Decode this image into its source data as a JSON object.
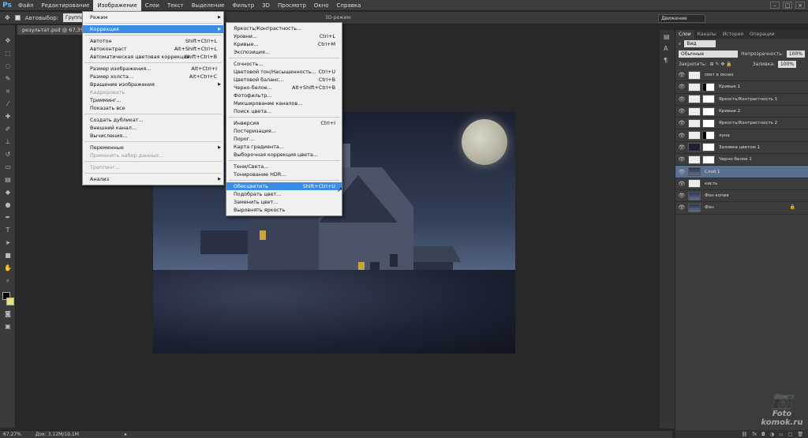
{
  "app": {
    "logo": "Ps"
  },
  "menubar": [
    "Файл",
    "Редактирование",
    "Изображение",
    "Слои",
    "Текст",
    "Выделение",
    "Фильтр",
    "3D",
    "Просмотр",
    "Окно",
    "Справка"
  ],
  "optbar": {
    "autoselect": "Автовыбор:",
    "group": "Группа",
    "mode3d": "3D-режим:",
    "workspace": "Движение"
  },
  "document": {
    "tab": "результат.psd @ 67,3% (С..."
  },
  "image_menu": [
    {
      "label": "Режим",
      "arrow": true
    },
    {
      "sep": true
    },
    {
      "label": "Коррекция",
      "arrow": true,
      "hl": true
    },
    {
      "sep": true
    },
    {
      "label": "Автотон",
      "sc": "Shift+Ctrl+L"
    },
    {
      "label": "Автоконтраст",
      "sc": "Alt+Shift+Ctrl+L"
    },
    {
      "label": "Автоматическая цветовая коррекция",
      "sc": "Shift+Ctrl+B"
    },
    {
      "sep": true
    },
    {
      "label": "Размер изображения...",
      "sc": "Alt+Ctrl+I"
    },
    {
      "label": "Размер холста...",
      "sc": "Alt+Ctrl+C"
    },
    {
      "label": "Вращение изображения",
      "arrow": true
    },
    {
      "label": "Кадрировать",
      "disabled": true
    },
    {
      "label": "Тримминг..."
    },
    {
      "label": "Показать все"
    },
    {
      "sep": true
    },
    {
      "label": "Создать дубликат..."
    },
    {
      "label": "Внешний канал..."
    },
    {
      "label": "Вычисления..."
    },
    {
      "sep": true
    },
    {
      "label": "Переменные",
      "arrow": true
    },
    {
      "label": "Применить набор данных...",
      "disabled": true
    },
    {
      "sep": true
    },
    {
      "label": "Треппинг...",
      "disabled": true
    },
    {
      "sep": true
    },
    {
      "label": "Анализ",
      "arrow": true
    }
  ],
  "adjust_menu": [
    {
      "label": "Яркость/Контрастность..."
    },
    {
      "label": "Уровни...",
      "sc": "Ctrl+L"
    },
    {
      "label": "Кривые...",
      "sc": "Ctrl+M"
    },
    {
      "label": "Экспозиция..."
    },
    {
      "sep": true
    },
    {
      "label": "Сочность..."
    },
    {
      "label": "Цветовой тон/Насыщенность...",
      "sc": "Ctrl+U"
    },
    {
      "label": "Цветовой баланс...",
      "sc": "Ctrl+B"
    },
    {
      "label": "Черно-белое...",
      "sc": "Alt+Shift+Ctrl+B"
    },
    {
      "label": "Фотофильтр..."
    },
    {
      "label": "Микширование каналов..."
    },
    {
      "label": "Поиск цвета..."
    },
    {
      "sep": true
    },
    {
      "label": "Инверсия",
      "sc": "Ctrl+I"
    },
    {
      "label": "Постеризация..."
    },
    {
      "label": "Порог..."
    },
    {
      "label": "Карта градиента..."
    },
    {
      "label": "Выборочная коррекция цвета..."
    },
    {
      "sep": true
    },
    {
      "label": "Тени/Света..."
    },
    {
      "label": "Тонирование HDR..."
    },
    {
      "sep": true
    },
    {
      "label": "Обесцветить",
      "sc": "Shift+Ctrl+U",
      "hl": true
    },
    {
      "label": "Подобрать цвет..."
    },
    {
      "label": "Заменить цвет..."
    },
    {
      "label": "Выровнять яркость"
    }
  ],
  "panel": {
    "tabs": [
      "Слои",
      "Каналы",
      "История",
      "Операции"
    ],
    "kind": "Вид",
    "blend": "Обычные",
    "opacity_label": "Непрозрачность:",
    "opacity": "100%",
    "lock_label": "Закрепить:",
    "fill_label": "Заливка:",
    "fill": "100%"
  },
  "layers": [
    {
      "name": "свет в окнах",
      "thumb": "light"
    },
    {
      "name": "Кривые 1",
      "thumb": "adj",
      "mask": "black"
    },
    {
      "name": "Яркость/Контрастность 1",
      "thumb": "adj",
      "mask": "white"
    },
    {
      "name": "Кривые 2",
      "thumb": "adj",
      "mask": "white"
    },
    {
      "name": "Яркость/Контрастность 2",
      "thumb": "adj",
      "mask": "white"
    },
    {
      "name": "луна",
      "thumb": "light",
      "mask": "black"
    },
    {
      "name": "Заливка цветом 1",
      "thumb": "dark",
      "mask": "white"
    },
    {
      "name": "Черно-белое 1",
      "thumb": "adj",
      "mask": "white"
    },
    {
      "name": "Слой 1",
      "thumb": "photo",
      "selected": true
    },
    {
      "name": "кисть",
      "thumb": "light"
    },
    {
      "name": "Фон копия",
      "thumb": "photo"
    },
    {
      "name": "Фон",
      "thumb": "photo",
      "locked": true
    }
  ],
  "status": {
    "zoom": "67,27%",
    "doc": "Док: 3,12M/19,1M"
  },
  "watermark": {
    "line1": "Foto",
    "line2": "komok.ru"
  },
  "colors": {
    "accent": "#3a8ee6",
    "selected_layer": "#5a7090",
    "fg": "#050505",
    "bg": "#e8e070"
  }
}
